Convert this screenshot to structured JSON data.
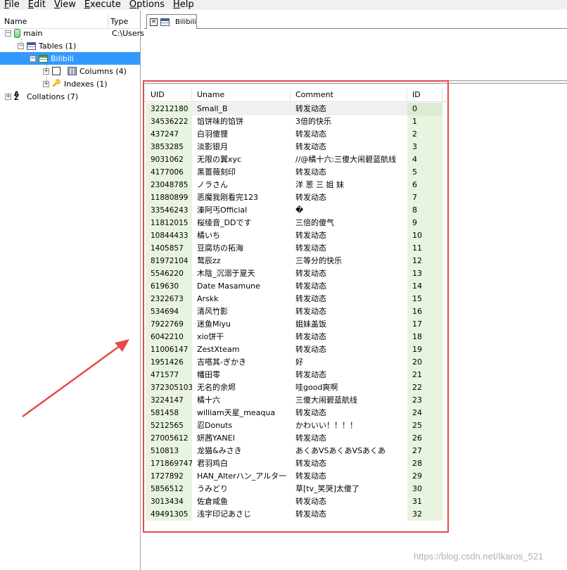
{
  "menu": [
    "File",
    "Edit",
    "View",
    "Execute",
    "Options",
    "Help"
  ],
  "tree": {
    "header": {
      "name": "Name",
      "type": "Type"
    },
    "db": {
      "label": "main",
      "type": "C:\\Users"
    },
    "tables": {
      "label": "Tables (1)"
    },
    "table": {
      "label": "Bilibili"
    },
    "columns": {
      "label": "Columns (4)"
    },
    "indexes": {
      "label": "Indexes (1)"
    },
    "collations": {
      "label": "Collations (7)"
    }
  },
  "tab": {
    "label": "Bilibili",
    "close": "×"
  },
  "grid": {
    "columns": [
      "UID",
      "Uname",
      "Comment",
      "ID"
    ],
    "rows": [
      [
        "32212180",
        "Small_B",
        "转发动态",
        "0"
      ],
      [
        "34536222",
        "馅饼味的馅饼",
        "3倍的快乐",
        "1"
      ],
      [
        "437247",
        "白羽傻狸",
        "转发动态",
        "2"
      ],
      [
        "3853285",
        "淡影银月",
        "转发动态",
        "3"
      ],
      [
        "9031062",
        "无限の翼xyc",
        "//@橘十六:三傻大闹碧蓝航线",
        "4"
      ],
      [
        "4177006",
        "黑蔷薇刻印",
        "转发动态",
        "5"
      ],
      [
        "23048785",
        "ノラさん",
        "洋 葱 三 姐 妹",
        "6"
      ],
      [
        "11880899",
        "恶魔我刚看完123",
        "转发动态",
        "7"
      ],
      [
        "33546243",
        "溱阿丐Official",
        "�",
        "8"
      ],
      [
        "11812015",
        "桜绫音_DDです",
        "三倍的傻气",
        "9"
      ],
      [
        "10844433",
        "橘いち",
        "转发动态",
        "10"
      ],
      [
        "1405857",
        "豆腐坊の拓海",
        "转发动态",
        "11"
      ],
      [
        "81972104",
        "鹜辰zz",
        "三等分的快乐",
        "12"
      ],
      [
        "5546220",
        "木陰_沉溺于夏天",
        "转发动态",
        "13"
      ],
      [
        "619630",
        "Date Masamune",
        "转发动态",
        "14"
      ],
      [
        "2322673",
        "Arskk",
        "转发动态",
        "15"
      ],
      [
        "534694",
        "清风竹影",
        "转发动态",
        "16"
      ],
      [
        "7922769",
        "迷鱼Miyu",
        "姐妹盖饭",
        "17"
      ],
      [
        "6042210",
        "xio饼干",
        "转发动态",
        "18"
      ],
      [
        "11006147",
        "ZestXteam",
        "转发动态",
        "19"
      ],
      [
        "1951426",
        "吉嗒其-ぎかき",
        "好",
        "20"
      ],
      [
        "471577",
        "幡田零",
        "转发动态",
        "21"
      ],
      [
        "372305103",
        "无名的余烬",
        "哇good爽啊",
        "22"
      ],
      [
        "3224147",
        "橘十六",
        "三傻大闹碧蓝航线",
        "23"
      ],
      [
        "581458",
        "william天星_meaqua",
        "转发动态",
        "24"
      ],
      [
        "5212565",
        "忍Donuts",
        "かわいい！！！！",
        "25"
      ],
      [
        "27005612",
        "妍茜YANEI",
        "转发动态",
        "26"
      ],
      [
        "510813",
        "龙猫&みさき",
        "あくあVSあくあVSあくあ",
        "27"
      ],
      [
        "171869747",
        "君羽鸡白",
        "转发动态",
        "28"
      ],
      [
        "1727892",
        "HAN_Alterハン_アルタ一",
        "转发动态",
        "29"
      ],
      [
        "5856512",
        "うみどり",
        "草[tv_笑哭]太傻了",
        "30"
      ],
      [
        "3013434",
        "佐倉咸鱼",
        "转发动态",
        "31"
      ],
      [
        "49491305",
        "浅字印记あさじ",
        "转发动态",
        "32"
      ]
    ]
  },
  "watermark": "https://blog.csdn.net/Ikaros_521",
  "colors": {
    "selection": "#3399ff",
    "annotation": "#e84a4a",
    "grid_key_bg": "#e8f3e0"
  }
}
